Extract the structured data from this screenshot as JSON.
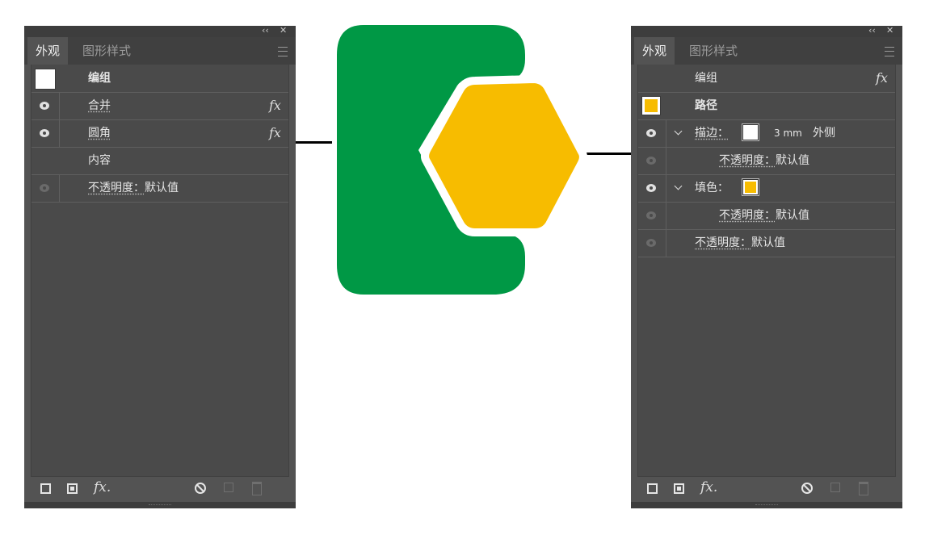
{
  "left_panel": {
    "controls": {
      "collapse": "‹‹",
      "close": "✕"
    },
    "tabs": [
      {
        "label": "外观"
      },
      {
        "label": "图形样式"
      }
    ],
    "rows": [
      {
        "label": "编组"
      },
      {
        "label": "合并",
        "fx": "fx"
      },
      {
        "label": "圆角",
        "fx": "fx"
      },
      {
        "label": "内容"
      },
      {
        "label": "不透明度：",
        "value": "默认值"
      }
    ],
    "bottom_fx": "fx."
  },
  "right_panel": {
    "controls": {
      "collapse": "‹‹",
      "close": "✕"
    },
    "tabs": [
      {
        "label": "外观"
      },
      {
        "label": "图形样式"
      }
    ],
    "rows": [
      {
        "label": "编组",
        "fx": "fx"
      },
      {
        "label": "路径"
      },
      {
        "label": "描边：",
        "weight": "3 mm",
        "align": "外侧"
      },
      {
        "label": "不透明度：",
        "value": "默认值"
      },
      {
        "label": "填色："
      },
      {
        "label": "不透明度：",
        "value": "默认值"
      },
      {
        "label": "不透明度：",
        "value": "默认值"
      }
    ],
    "bottom_fx": "fx."
  },
  "colors": {
    "green": "#009845",
    "yellow": "#F7BC00",
    "panel": "#535353"
  }
}
